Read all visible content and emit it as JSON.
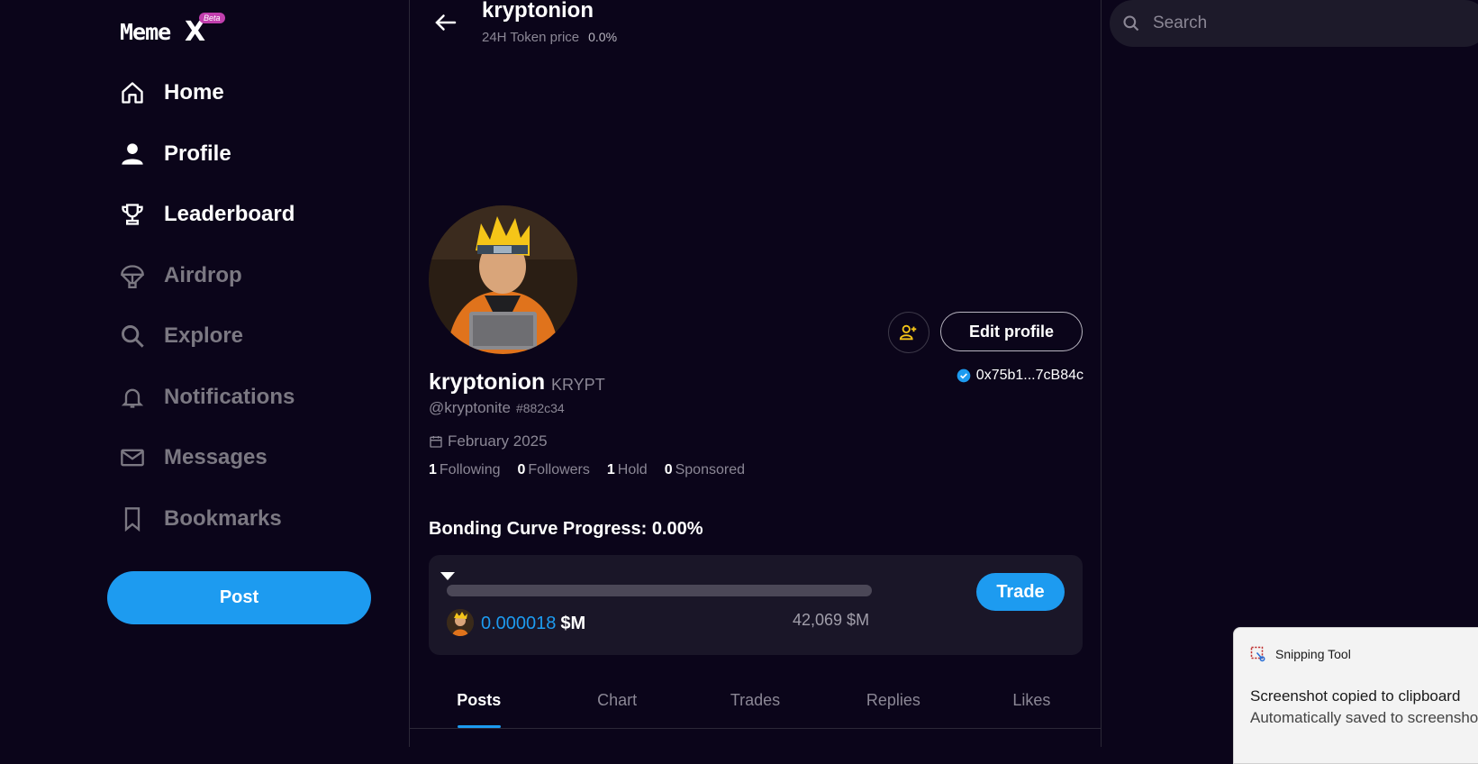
{
  "brand": {
    "logo_text": "Meme",
    "logo_x": "X",
    "beta": "Beta"
  },
  "sidebar": {
    "items": [
      {
        "label": "Home",
        "icon": "home-icon",
        "active": true
      },
      {
        "label": "Profile",
        "icon": "user-icon",
        "active": true
      },
      {
        "label": "Leaderboard",
        "icon": "trophy-icon",
        "active": true
      },
      {
        "label": "Airdrop",
        "icon": "parachute-icon",
        "active": false
      },
      {
        "label": "Explore",
        "icon": "search-icon",
        "active": false
      },
      {
        "label": "Notifications",
        "icon": "bell-icon",
        "active": false
      },
      {
        "label": "Messages",
        "icon": "mail-icon",
        "active": false
      },
      {
        "label": "Bookmarks",
        "icon": "bookmark-icon",
        "active": false
      }
    ],
    "post_label": "Post"
  },
  "header": {
    "title": "kryptonion",
    "subtitle": "24H Token price",
    "change": "0.0%"
  },
  "profile": {
    "name": "kryptonion",
    "ticker": "KRYPT",
    "handle": "@kryptonite",
    "hash_id": "#882c34",
    "joined": "February 2025",
    "wallet": "0x75b1...7cB84c",
    "edit_label": "Edit profile",
    "stats": {
      "following_count": "1",
      "following_label": "Following",
      "followers_count": "0",
      "followers_label": "Followers",
      "hold_count": "1",
      "hold_label": "Hold",
      "sponsored_count": "0",
      "sponsored_label": "Sponsored"
    }
  },
  "bonding": {
    "title": "Bonding Curve Progress: 0.00%",
    "progress": 0.0,
    "price_value": "0.000018",
    "price_unit": "$M",
    "target": "42,069 $M",
    "trade_label": "Trade"
  },
  "tabs": [
    {
      "label": "Posts",
      "active": true
    },
    {
      "label": "Chart",
      "active": false
    },
    {
      "label": "Trades",
      "active": false
    },
    {
      "label": "Replies",
      "active": false
    },
    {
      "label": "Likes",
      "active": false
    }
  ],
  "search": {
    "placeholder": "Search"
  },
  "toast": {
    "app": "Snipping Tool",
    "line1": "Screenshot copied to clipboard",
    "line2": "Automatically saved to screenshots folder"
  },
  "colors": {
    "background": "#0b051a",
    "accent": "#1d9bf0",
    "muted": "#8b8795",
    "beta": "#c13fae"
  }
}
